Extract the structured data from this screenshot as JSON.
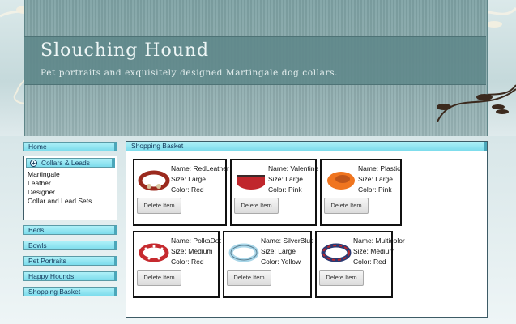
{
  "header": {
    "title": "Slouching Hound",
    "tagline": "Pet portraits and exquisitely designed Martingale dog collars."
  },
  "sidebar": {
    "home": "Home",
    "collars": {
      "label": "Collars & Leads",
      "expand_icon": "plus-circle-icon",
      "items": [
        "Martingale",
        "Leather",
        "Designer",
        "Collar and Lead Sets"
      ]
    },
    "beds": "Beds",
    "bowls": "Bowls",
    "pet_portraits": "Pet Portraits",
    "happy_hounds": "Happy Hounds",
    "shopping_basket": "Shopping Basket"
  },
  "main": {
    "heading": "Shopping Basket",
    "delete_label": "Delete Item",
    "items": [
      {
        "name": "Name: RedLeather",
        "size": "Size: Large",
        "color": "Color: Red",
        "swatch": "#9b2a1e",
        "accent": "#d9c7a0"
      },
      {
        "name": "Name: Valentine",
        "size": "Size: Large",
        "color": "Color: Pink",
        "swatch": "#c0262c",
        "accent": "#3a2a2a"
      },
      {
        "name": "Name: Plastic",
        "size": "Size: Large",
        "color": "Color: Pink",
        "swatch": "#f0751f",
        "accent": "#c0561a"
      },
      {
        "name": "Name: PolkaDot",
        "size": "Size: Medium",
        "color": "Color: Red",
        "swatch": "#c62a2f",
        "accent": "#ffffff"
      },
      {
        "name": "Name: SilverBlue",
        "size": "Size: Large",
        "color": "Color: Yellow",
        "swatch": "#a9d6e8",
        "accent": "#5a7f92"
      },
      {
        "name": "Name: Multicolor",
        "size": "Size: Medium",
        "color": "Color: Red",
        "swatch": "#b8262d",
        "accent": "#2b3a73"
      }
    ]
  },
  "colors": {
    "nav_bar": "#7ddcec",
    "nav_border": "#4ba7ba",
    "banner": "#8aa9ab"
  }
}
